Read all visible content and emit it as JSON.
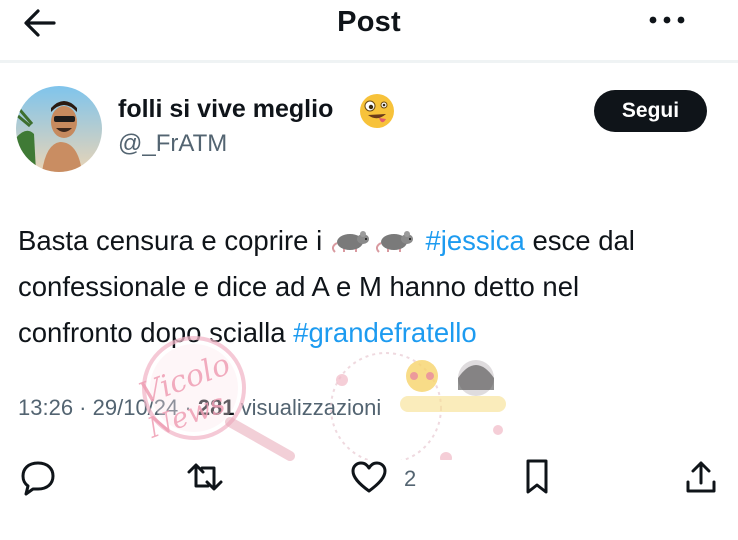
{
  "header": {
    "title": "Post"
  },
  "user": {
    "display_name": "folli si vive meglio",
    "handle": "@_FrATM"
  },
  "follow_label": "Segui",
  "tweet": {
    "line1_text": "Basta censura e coprire i ",
    "line1_hashtag": "#jessica",
    "line1_end": " esce dal",
    "line2": "confessionale e dice ad A e M hanno detto nel",
    "line3_text": "confronto dopo scialla ",
    "line3_hashtag": "#grandefratello"
  },
  "meta": {
    "time": "13:26",
    "sep1": " · ",
    "date": "29/10/24",
    "sep2": " · ",
    "views": "281",
    "views_label": " visualizzazioni"
  },
  "actions": {
    "like_count": "2"
  },
  "watermark": {
    "text1": "Vicolo",
    "text2": "News"
  },
  "colors": {
    "accent": "#1d9bf0",
    "text": "#0f1419",
    "muted": "#536471",
    "watermark": "#f2b7c8"
  }
}
